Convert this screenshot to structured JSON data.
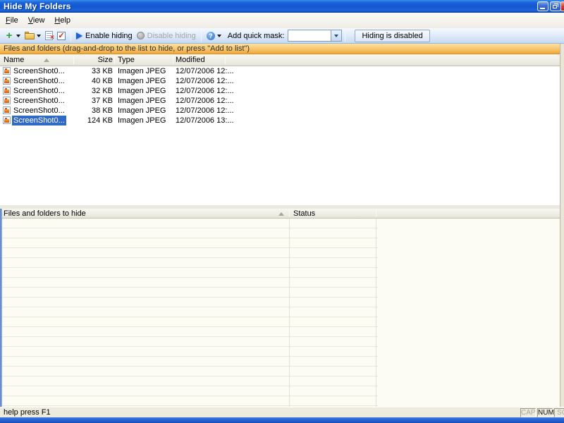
{
  "window": {
    "title": "Hide My Folders",
    "controls": {
      "minimize": "minimize",
      "restore": "restore",
      "close": "close"
    }
  },
  "menu": {
    "items": [
      {
        "key": "F",
        "rest": "ile"
      },
      {
        "key": "V",
        "rest": "iew"
      },
      {
        "key": "H",
        "rest": "elp"
      }
    ]
  },
  "toolbar": {
    "add_glyph": "+",
    "remove_glyph": "×",
    "check_glyph": "✓",
    "mask_icon_glyph": "?",
    "enable_label": "Enable hiding",
    "disable_label": "Disable hiding",
    "mask_label": "Add quick mask:",
    "mask_value": "",
    "hiding_status": "Hiding is disabled"
  },
  "infobar": {
    "text": "Files and folders (drag-and-drop to the list to hide, or press \"Add to list\")"
  },
  "file_table": {
    "columns": [
      "Name",
      "Size",
      "Type",
      "Modified"
    ],
    "selected_index": 5,
    "rows": [
      {
        "name": "ScreenShot0...",
        "size": "33 KB",
        "type": "Imagen JPEG",
        "modified": "12/07/2006 12:..."
      },
      {
        "name": "ScreenShot0...",
        "size": "40 KB",
        "type": "Imagen JPEG",
        "modified": "12/07/2006 12:..."
      },
      {
        "name": "ScreenShot0...",
        "size": "32 KB",
        "type": "Imagen JPEG",
        "modified": "12/07/2006 12:..."
      },
      {
        "name": "ScreenShot0...",
        "size": "37 KB",
        "type": "Imagen JPEG",
        "modified": "12/07/2006 12:..."
      },
      {
        "name": "ScreenShot0...",
        "size": "38 KB",
        "type": "Imagen JPEG",
        "modified": "12/07/2006 12:..."
      },
      {
        "name": "ScreenShot0...",
        "size": "124 KB",
        "type": "Imagen JPEG",
        "modified": "12/07/2006 13:..."
      }
    ]
  },
  "hide_table": {
    "name_header": "Files and folders to hide",
    "status_header": "Status"
  },
  "statusbar": {
    "help_text": "help press F1",
    "cap": "CAP",
    "num": "NUM",
    "scroll": "SC"
  },
  "colors": {
    "selection": "#316AC5",
    "titlebar_blue": "#1556CC",
    "infobar_top": "#FCE2A4",
    "infobar_bottom": "#EFA63C",
    "window_border_blue": "#2664D6"
  }
}
